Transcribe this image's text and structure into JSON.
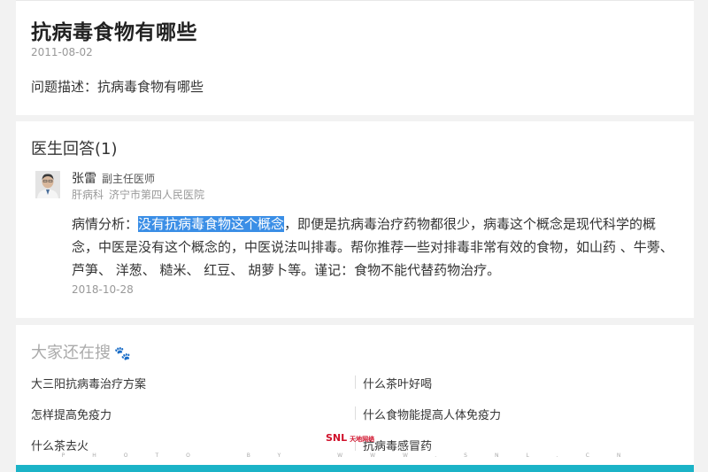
{
  "question": {
    "title": "抗病毒食物有哪些",
    "date": "2011-08-02",
    "description": "问题描述：抗病毒食物有哪些"
  },
  "answers": {
    "heading": "医生回答(1)",
    "doctor": {
      "name": "张雷",
      "title": "副主任医师",
      "department": "肝病科",
      "hospital": "济宁市第四人民医院"
    },
    "body_prefix": "病情分析：",
    "body_highlight": "没有抗病毒食物这个概念",
    "body_rest": "，即便是抗病毒治疗药物都很少，病毒这个概念是现代科学的概念，中医是没有这个概念的，中医说法叫排毒。帮你推荐一些对排毒非常有效的食物，如山药 、牛蒡、 芦笋、 洋葱、 糙米、 红豆、 胡萝卜等。谨记：食物不能代替药物治疗。",
    "date": "2018-10-28"
  },
  "related": {
    "heading": "大家还在搜",
    "items": [
      "大三阳抗病毒治疗方案",
      "什么茶叶好喝",
      "怎样提高免疫力",
      "什么食物能提高人体免疫力",
      "什么茶去火",
      "抗病毒感冒药"
    ]
  },
  "watermark": {
    "text": "PHOTO BY WWW.SNL.CN",
    "logo": "SNL",
    "logo_sub": "天地网络"
  },
  "colors": {
    "highlight": "#3a8ee6",
    "bottom_bar": "#1bb3c7",
    "logo": "#d0102a"
  }
}
